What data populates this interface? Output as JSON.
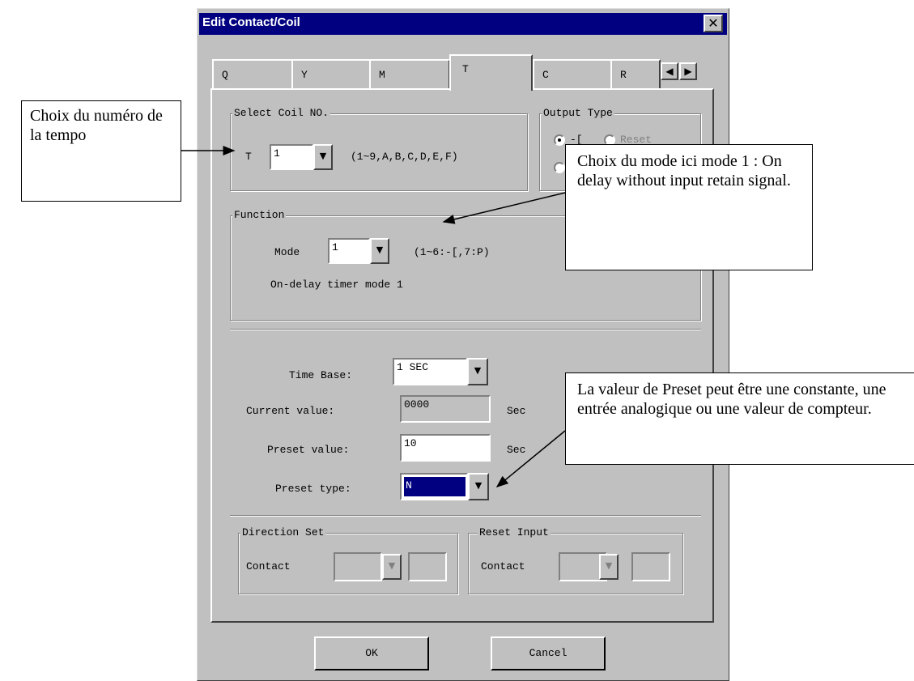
{
  "dialog": {
    "title": "Edit Contact/Coil"
  },
  "tabs": [
    {
      "label": "Q"
    },
    {
      "label": "Y"
    },
    {
      "label": "M"
    },
    {
      "label": "T"
    },
    {
      "label": "C"
    },
    {
      "label": "R"
    }
  ],
  "select_coil": {
    "legend": "Select Coil NO.",
    "prefix": "T",
    "value": "1",
    "hint": "(1~9,A,B,C,D,E,F)"
  },
  "output_type": {
    "legend": "Output Type",
    "option1": "-[",
    "option2": "Reset"
  },
  "function": {
    "legend": "Function",
    "mode_label": "Mode",
    "mode_value": "1",
    "mode_hint": "(1~6:-[,7:P)",
    "description": "On-delay timer mode 1"
  },
  "time": {
    "time_base_label": "Time Base:",
    "time_base_value": "1 SEC",
    "current_label": "Current value:",
    "current_value": "0000",
    "current_unit": "Sec",
    "preset_label": "Preset value:",
    "preset_value": "10",
    "preset_unit": "Sec",
    "preset_type_label": "Preset type:",
    "preset_type_value": "N"
  },
  "direction_set": {
    "legend": "Direction Set",
    "contact_label": "Contact"
  },
  "reset_input": {
    "legend": "Reset Input",
    "contact_label": "Contact"
  },
  "buttons": {
    "ok": "OK",
    "cancel": "Cancel"
  },
  "callouts": {
    "coil_number": "Choix du numéro de la tempo",
    "mode": "Choix du mode ici mode 1 : On delay without input retain signal.",
    "preset": "La valeur de Preset peut être une constante, une entrée analogique ou une valeur de compteur."
  },
  "colors": {
    "title_bar": "#000080",
    "dialog_bg": "#c0c0c0",
    "selection": "#000080"
  }
}
